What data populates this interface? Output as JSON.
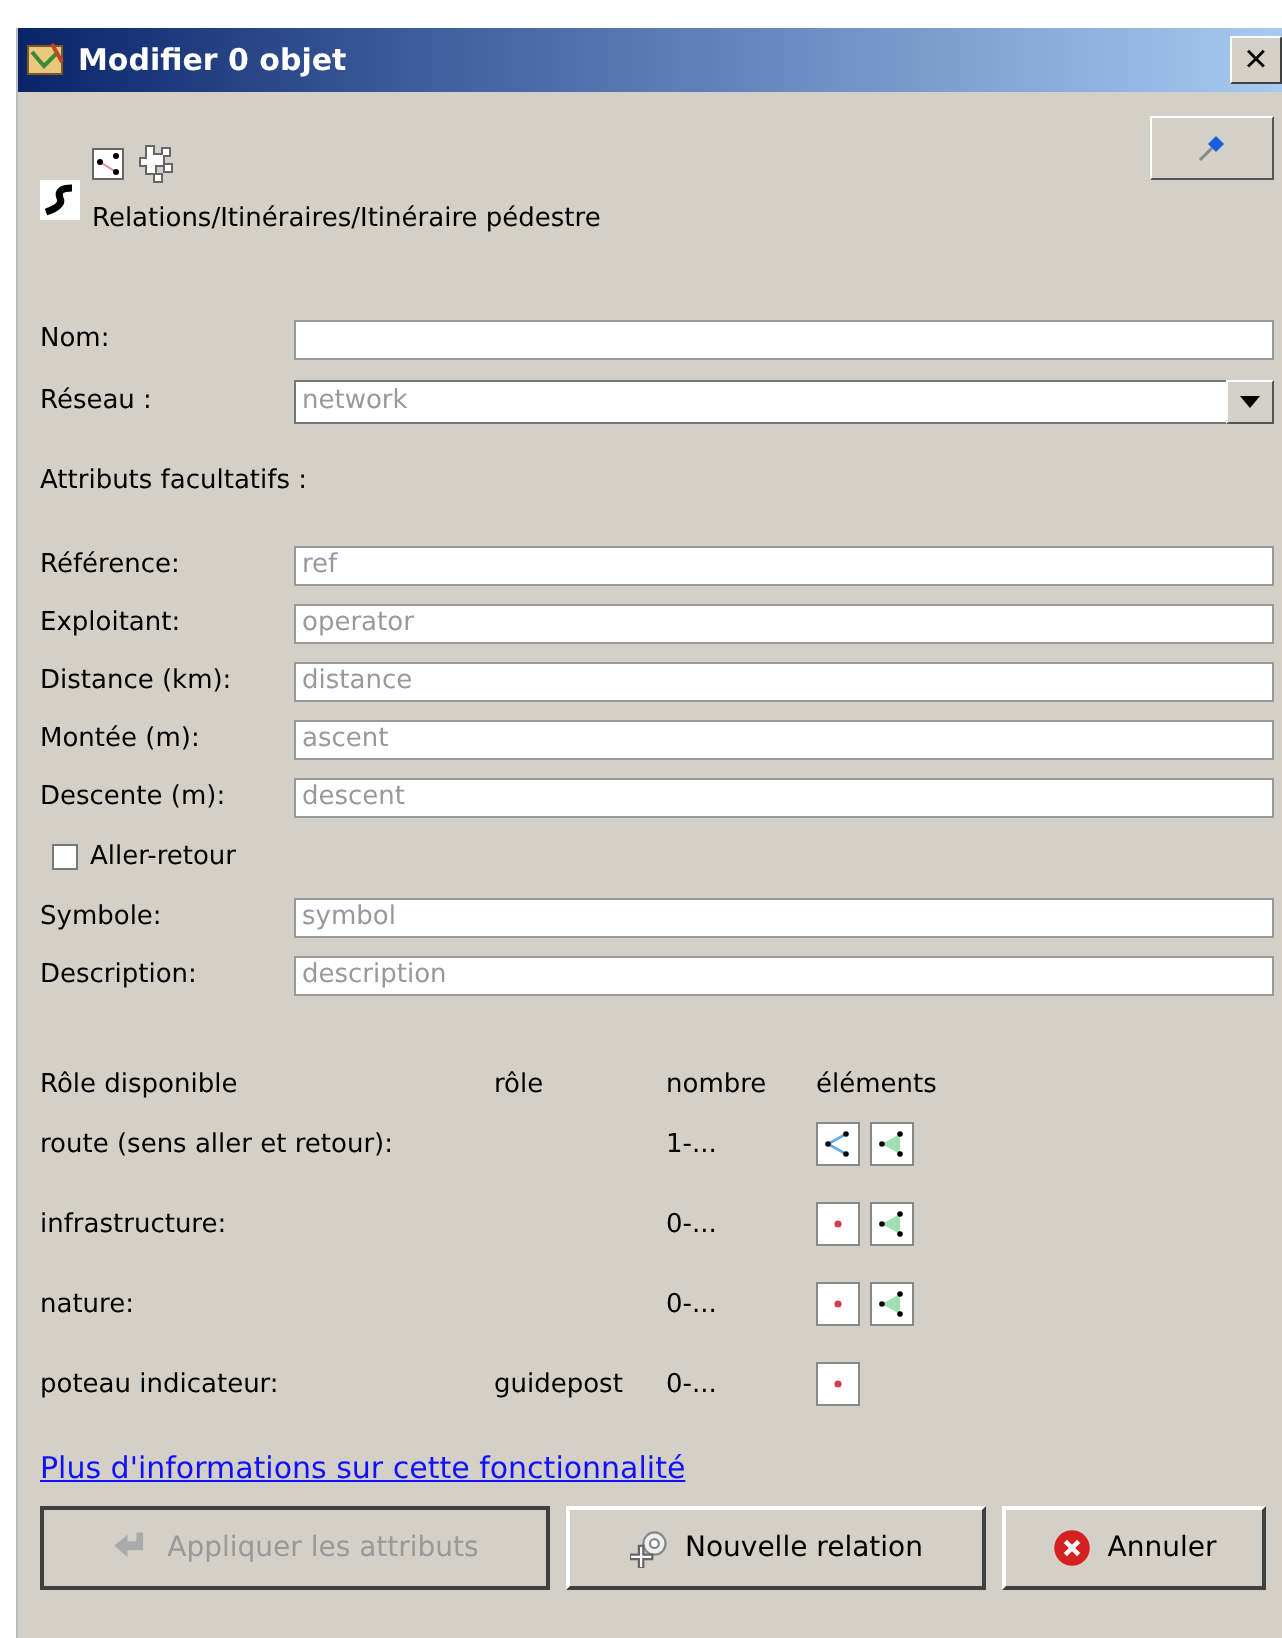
{
  "window": {
    "title": "Modifier 0 objet",
    "close": "×"
  },
  "preset": {
    "path": "Relations/Itinéraires/Itinéraire pédestre"
  },
  "fields": [
    {
      "label": "Nom:",
      "kind": "text"
    },
    {
      "label": "Réseau :",
      "kind": "combo",
      "placeholder": "network"
    }
  ],
  "optional_heading": "Attributs facultatifs :",
  "optional": [
    {
      "kind": "field",
      "label": "Référence:",
      "placeholder": "ref"
    },
    {
      "kind": "field",
      "label": "Exploitant:",
      "placeholder": "operator"
    },
    {
      "kind": "field",
      "label": "Distance (km):",
      "placeholder": "distance"
    },
    {
      "kind": "field",
      "label": "Montée (m):",
      "placeholder": "ascent"
    },
    {
      "kind": "field",
      "label": "Descente (m):",
      "placeholder": "descent"
    },
    {
      "kind": "checkbox",
      "label": "Aller-retour",
      "checked": false
    },
    {
      "kind": "field",
      "label": "Symbole:",
      "placeholder": "symbol"
    },
    {
      "kind": "field",
      "label": "Description:",
      "placeholder": "description"
    }
  ],
  "roles": {
    "columns": [
      "Rôle disponible",
      "rôle",
      "nombre",
      "éléments"
    ],
    "rows": [
      {
        "name": "route (sens aller et retour):",
        "count": "1-...",
        "elements": [
          {
            "kind": "way"
          },
          {
            "kind": "area"
          }
        ]
      },
      {
        "name": "infrastructure:",
        "count": "0-...",
        "elements": [
          {
            "kind": "node"
          },
          {
            "kind": "area"
          }
        ]
      },
      {
        "name": "nature:",
        "count": "0-...",
        "elements": [
          {
            "kind": "node"
          },
          {
            "kind": "area"
          }
        ]
      },
      {
        "name": "poteau indicateur:",
        "role": "guidepost",
        "count": "0-...",
        "elements": [
          {
            "kind": "node"
          }
        ]
      }
    ]
  },
  "link": "Plus d'informations sur cette fonctionnalité",
  "buttons": [
    {
      "label": "Appliquer les attributs",
      "kind": "apply",
      "disabled": true
    },
    {
      "label": "Nouvelle relation",
      "kind": "new",
      "disabled": false
    },
    {
      "label": "Annuler",
      "kind": "cancel",
      "disabled": false
    }
  ]
}
